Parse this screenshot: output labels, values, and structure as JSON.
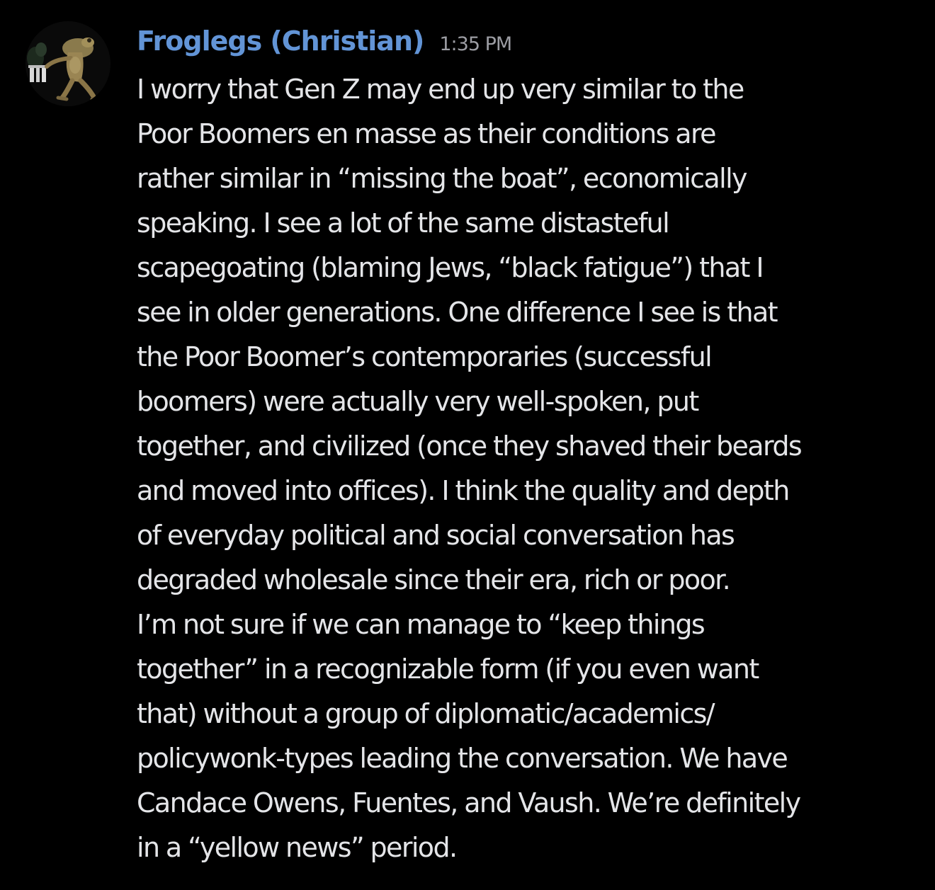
{
  "message": {
    "author": "Froglegs (Christian)",
    "timestamp": "1:35 PM",
    "avatar_icon": "frog-avatar-icon",
    "colors": {
      "background": "#000000",
      "username": "#6294d6",
      "timestamp": "#9c9da3",
      "text": "#e4e5e8"
    },
    "lines": [
      "I worry that Gen Z may end up very similar to the",
      "Poor Boomers en masse as their conditions are",
      "rather similar in “missing the boat”, economically",
      "speaking. I see a lot of the same distasteful",
      "scapegoating (blaming Jews, “black fatigue”) that I",
      "see in older generations. One difference I see is that",
      "the Poor Boomer’s contemporaries (successful",
      "boomers) were actually very well-spoken, put",
      "together, and civilized (once they shaved their beards",
      "and moved into offices). I think the quality and depth",
      "of everyday political and social conversation has",
      "degraded wholesale since their era, rich or poor.",
      "I’m not sure if we can manage to “keep things",
      "together” in a recognizable form (if you even want",
      "that) without a group of diplomatic/academics/",
      "policywonk-types  leading the conversation. We have",
      "Candace Owens, Fuentes, and Vaush. We’re definitely",
      "in a “yellow news” period."
    ]
  }
}
